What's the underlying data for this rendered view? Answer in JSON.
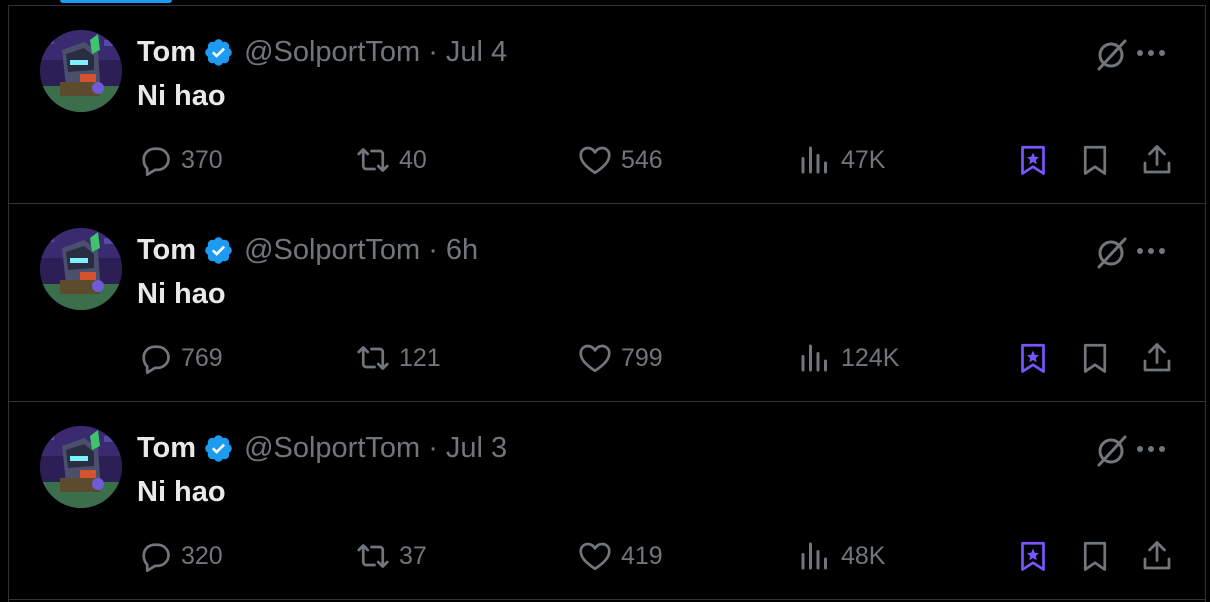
{
  "tweets": [
    {
      "author_name": "Tom",
      "handle": "@SolportTom",
      "separator": "·",
      "time": "Jul 4",
      "text": "Ni hao",
      "replies": "370",
      "retweets": "40",
      "likes": "546",
      "views": "47K"
    },
    {
      "author_name": "Tom",
      "handle": "@SolportTom",
      "separator": "·",
      "time": "6h",
      "text": "Ni hao",
      "replies": "769",
      "retweets": "121",
      "likes": "799",
      "views": "124K"
    },
    {
      "author_name": "Tom",
      "handle": "@SolportTom",
      "separator": "·",
      "time": "Jul 3",
      "text": "Ni hao",
      "replies": "320",
      "retweets": "37",
      "likes": "419",
      "views": "48K"
    }
  ],
  "colors": {
    "background": "#000000",
    "text_primary": "#e7e9ea",
    "text_secondary": "#71767b",
    "verified_badge": "#1d9bf0",
    "bookmark_accent": "#7856ff",
    "divider": "#2f3336"
  },
  "icons": {
    "reply": "reply-icon",
    "retweet": "retweet-icon",
    "like": "heart-icon",
    "views": "views-chart-icon",
    "grok": "grok-icon",
    "more": "more-dots-icon",
    "bookmark_folder": "bookmark-star-icon",
    "bookmark": "bookmark-icon",
    "share": "share-icon"
  }
}
